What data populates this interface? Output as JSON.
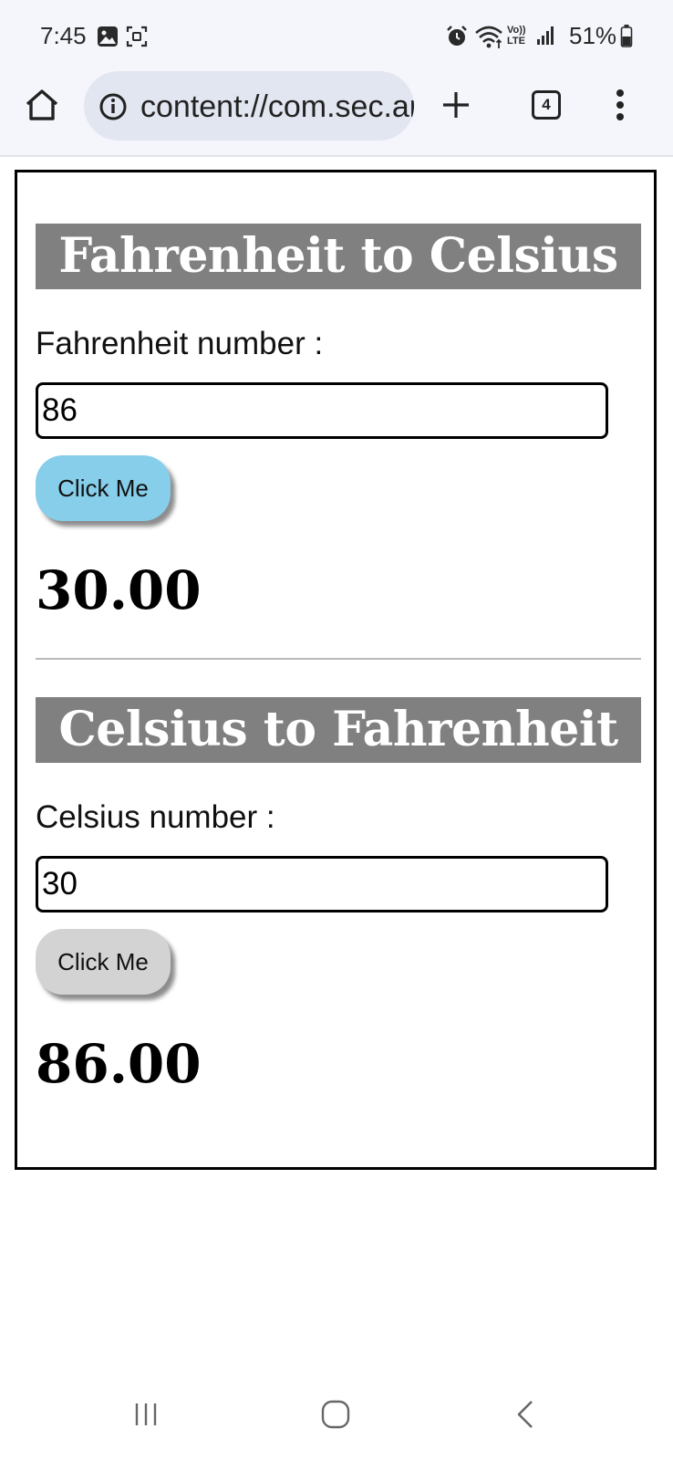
{
  "status_bar": {
    "time": "7:45",
    "battery": "51%",
    "icons": [
      "gallery-icon",
      "screen-capture-icon",
      "alarm-icon",
      "wifi-icon",
      "volte-icon",
      "signal-icon",
      "battery-icon"
    ],
    "volte_label": "Vo)) LTE"
  },
  "browser": {
    "url": "content://com.sec.android.app.myfiles",
    "tabs_count": "4",
    "icons": [
      "home-icon",
      "info-icon",
      "new-tab-icon",
      "tabs-icon",
      "more-icon"
    ]
  },
  "page": {
    "fahrenheit_to_celsius": {
      "title": "Fahrenheit to Celsius",
      "label": "Fahrenheit number :",
      "input_value": "86",
      "button_label": "Click Me",
      "button_color": "#87ceeb",
      "result": "30.00"
    },
    "celsius_to_fahrenheit": {
      "title": "Celsius to Fahrenheit",
      "label": "Celsius number :",
      "input_value": "30",
      "button_label": "Click Me",
      "button_color": "#d3d3d3",
      "result": "86.00"
    },
    "title_background": "#808080"
  },
  "nav_bar": {
    "icons": [
      "recent-apps-icon",
      "home-nav-icon",
      "back-icon"
    ]
  }
}
